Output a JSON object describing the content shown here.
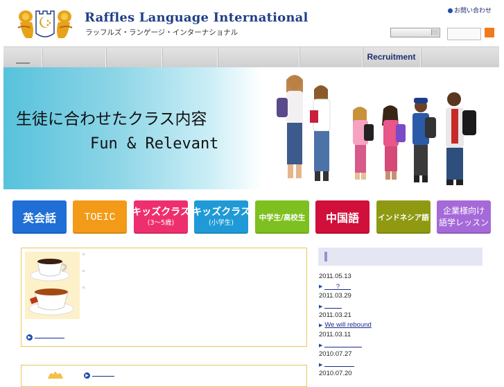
{
  "header": {
    "brand_title": "Raffles Language International",
    "brand_subtitle": "ラッフルズ・ランゲージ・インターナショナル",
    "contact_link": "お問い合わせ"
  },
  "nav": {
    "items": [
      {
        "label": ""
      },
      {
        "label": ""
      },
      {
        "label": ""
      },
      {
        "label": ""
      },
      {
        "label": ""
      },
      {
        "label": ""
      },
      {
        "label": "Recruitment"
      },
      {
        "label": ""
      }
    ]
  },
  "hero": {
    "headline_jp": "生徒に合わせたクラス内容",
    "headline_en": "Fun & Relevant"
  },
  "categories": [
    {
      "line1": "英会話",
      "line2": "",
      "color": "#1f6fd6"
    },
    {
      "line1": "TOEIC",
      "line2": "",
      "color": "#f39a18"
    },
    {
      "line1": "キッズクラス",
      "line2": "(3〜5歳)",
      "color": "#ee2f6e"
    },
    {
      "line1": "キッズクラス",
      "line2": "(小学生)",
      "color": "#1f9ad6"
    },
    {
      "line1": "中学生/高校生",
      "line2": "",
      "color": "#7dc01f"
    },
    {
      "line1": "中国語",
      "line2": "",
      "color": "#d0103a"
    },
    {
      "line1": "インドネシア語",
      "line2": "",
      "color": "#8f9a12"
    },
    {
      "line1": "企業様向け",
      "line2": "語学レッスン",
      "color": "#a569d8"
    }
  ],
  "feature_box": {
    "bullets": [
      "",
      "",
      ""
    ]
  },
  "news": {
    "items": [
      {
        "date": "2011.05.13",
        "link": "?"
      },
      {
        "date": "2011.03.29",
        "link": ""
      },
      {
        "date": "2011.03.21",
        "link": "We will rebound"
      },
      {
        "date": "2011.03.11",
        "link": ""
      },
      {
        "date": "2010.07.27",
        "link": ""
      },
      {
        "date": "2010.07.20",
        "link": ""
      }
    ]
  }
}
